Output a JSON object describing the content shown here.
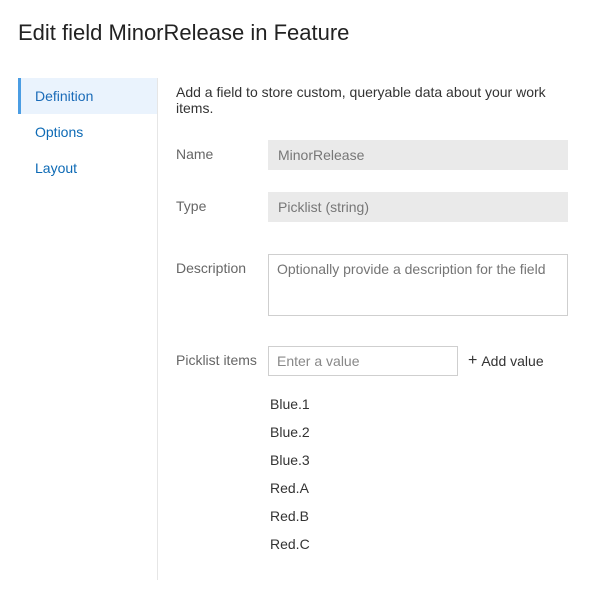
{
  "page_title": "Edit field MinorRelease in Feature",
  "sidebar": {
    "tabs": [
      {
        "label": "Definition",
        "active": true
      },
      {
        "label": "Options",
        "active": false
      },
      {
        "label": "Layout",
        "active": false
      }
    ]
  },
  "intro_text": "Add a field to store custom, queryable data about your work items.",
  "form": {
    "name_label": "Name",
    "name_value": "MinorRelease",
    "type_label": "Type",
    "type_value": "Picklist (string)",
    "description_label": "Description",
    "description_placeholder": "Optionally provide a description for the field",
    "picklist_label": "Picklist items",
    "picklist_placeholder": "Enter a value",
    "add_value_label": "Add value",
    "picklist_items": [
      "Blue.1",
      "Blue.2",
      "Blue.3",
      "Red.A",
      "Red.B",
      "Red.C"
    ]
  }
}
